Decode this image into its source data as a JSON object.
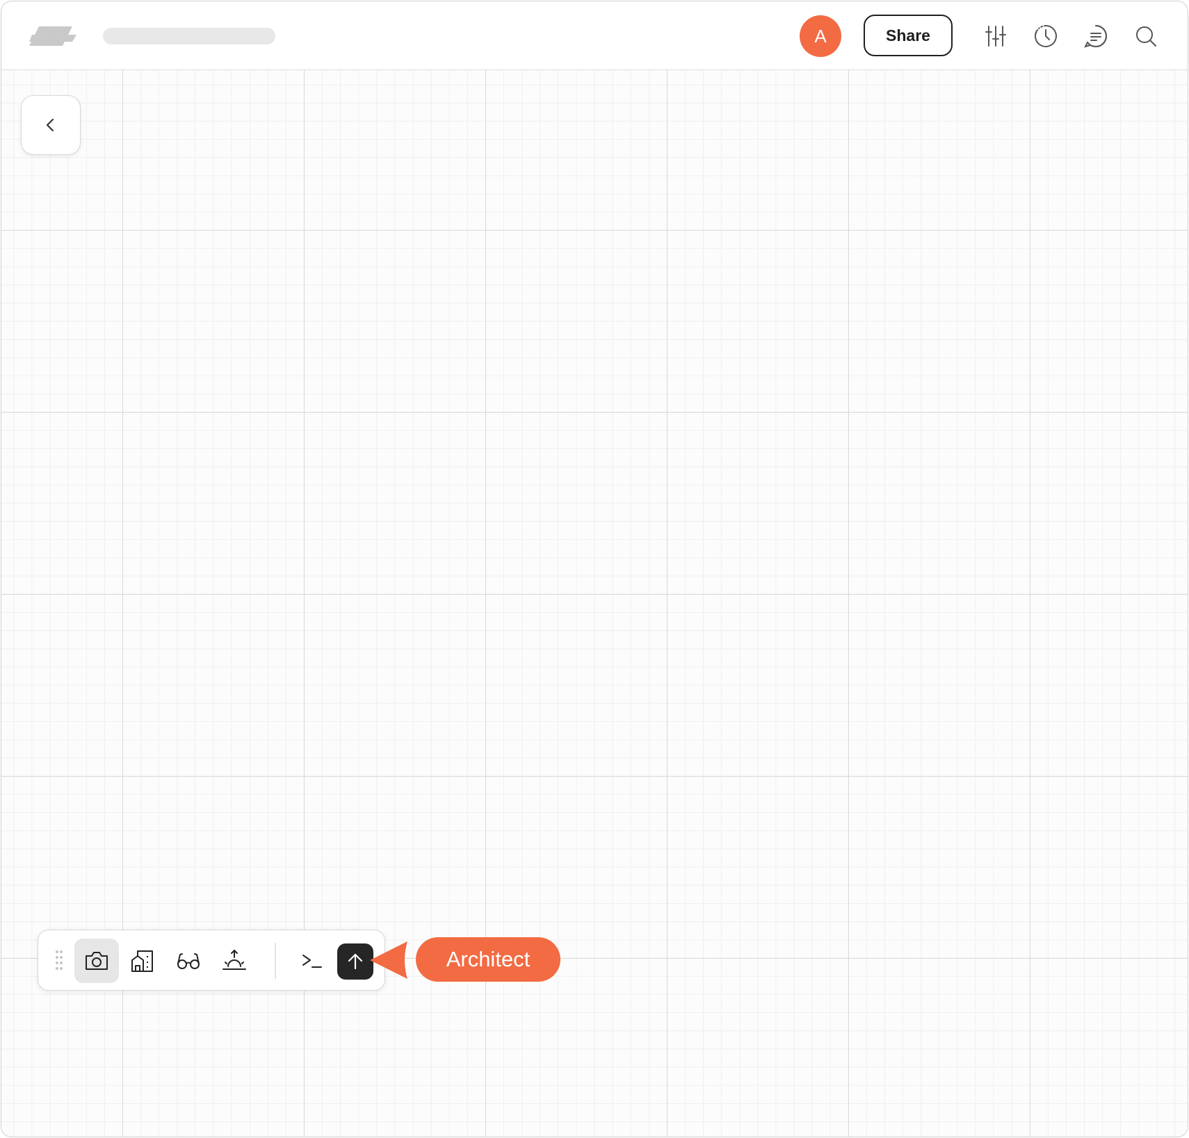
{
  "header": {
    "avatar_initial": "A",
    "share_label": "Share",
    "icons": [
      "logo-icon",
      "sliders-icon",
      "history-icon",
      "comment-icon",
      "search-icon"
    ]
  },
  "navigation": {
    "back_icon": "chevron-left-icon"
  },
  "toolbar": {
    "tools": [
      {
        "icon": "camera-icon",
        "active": true
      },
      {
        "icon": "building-icon",
        "active": false
      },
      {
        "icon": "glasses-icon",
        "active": false
      },
      {
        "icon": "sunrise-icon",
        "active": false
      },
      {
        "icon": "terminal-icon",
        "active": false
      }
    ],
    "send_icon": "arrow-up-icon"
  },
  "callout": {
    "label": "Architect"
  },
  "colors": {
    "accent": "#f26b43",
    "dark": "#262626",
    "grid_major": "#d9d9d9",
    "grid_minor": "#efefef"
  }
}
